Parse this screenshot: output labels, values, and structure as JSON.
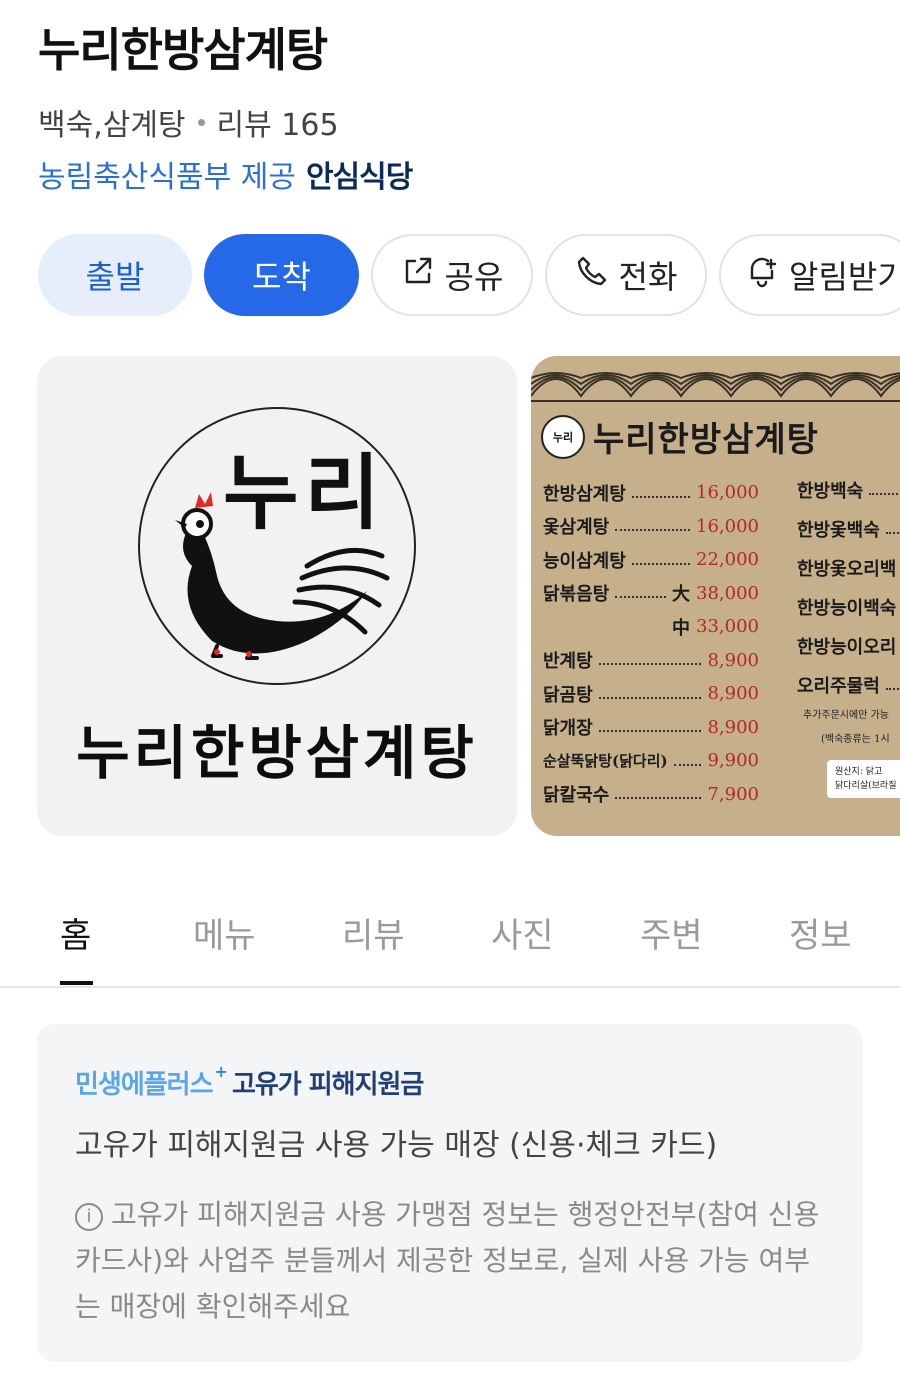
{
  "place": {
    "title": "누리한방삼계탕",
    "category": "백숙,삼계탕",
    "review_label": "리뷰 165",
    "cert_provider": "농림축산식품부 제공",
    "cert_brand": "안심식당"
  },
  "actions": {
    "depart": "출발",
    "arrive": "도착",
    "share": "공유",
    "call": "전화",
    "alert": "알림받기"
  },
  "photos": {
    "logo_top": "누리",
    "logo_name": "누리한방삼계탕",
    "menu_badge": "누리",
    "menu_title": "누리한방삼계탕",
    "menu_left": [
      {
        "name": "한방삼계탕",
        "size": "",
        "price": "16,000"
      },
      {
        "name": "옻삼계탕",
        "size": "",
        "price": "16,000"
      },
      {
        "name": "능이삼계탕",
        "size": "",
        "price": "22,000"
      },
      {
        "name": "닭볶음탕",
        "size": "大",
        "price": "38,000"
      },
      {
        "name": "",
        "size": "中",
        "price": "33,000"
      },
      {
        "name": "반계탕",
        "size": "",
        "price": "8,900"
      },
      {
        "name": "닭곰탕",
        "size": "",
        "price": "8,900"
      },
      {
        "name": "닭개장",
        "size": "",
        "price": "8,900"
      },
      {
        "name": "순살뚝닭탕(닭다리)",
        "size": "",
        "price": "9,900"
      },
      {
        "name": "닭칼국수",
        "size": "",
        "price": "7,900"
      }
    ],
    "menu_right": [
      "한방백숙",
      "한방옻백숙",
      "한방옻오리백",
      "한방능이백숙",
      "한방능이오리",
      "오리주물럭"
    ],
    "note1": "추가주문시에만 가능",
    "note2": "(백숙종류는 1시",
    "origin_line1": "원산지: 닭고",
    "origin_line2": "닭다리살(브라질"
  },
  "tabs": [
    "홈",
    "메뉴",
    "리뷰",
    "사진",
    "주변",
    "정보"
  ],
  "active_tab": "홈",
  "notice": {
    "brand1": "민생에플러스",
    "brand_plus": "+",
    "brand2": "고유가 피해지원금",
    "line": "고유가 피해지원금 사용 가능 매장 (신용·체크 카드)",
    "info_icon": "i",
    "note": "고유가 피해지원금 사용 가맹점 정보는 행정안전부(참여 신용카드사)와 사업주 분들께서 제공한 정보로, 실제 사용 가능 여부는 매장에 확인해주세요"
  },
  "colors": {
    "primary": "#2569e8",
    "depart_bg": "#e6eefb",
    "link": "#2b6fd6",
    "menu_board": "#c6b08c",
    "price_red": "#b52a1f"
  }
}
